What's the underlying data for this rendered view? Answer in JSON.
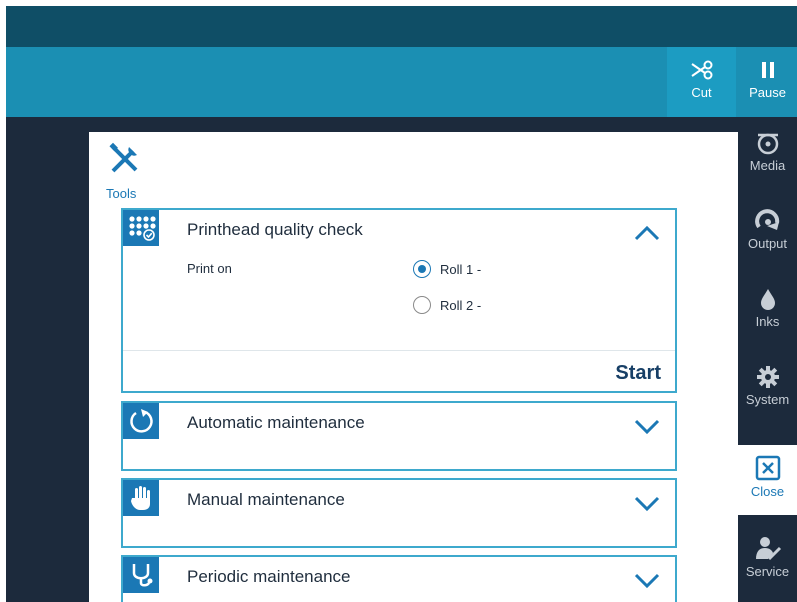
{
  "toolbar": {
    "cut_label": "Cut",
    "pause_label": "Pause"
  },
  "sidebar": {
    "items": [
      {
        "label": "Media",
        "icon": "media-roll-icon"
      },
      {
        "label": "Output",
        "icon": "output-icon"
      },
      {
        "label": "Inks",
        "icon": "ink-drop-icon"
      },
      {
        "label": "System",
        "icon": "gear-icon"
      },
      {
        "label": "Close",
        "icon": "close-icon"
      },
      {
        "label": "Service",
        "icon": "service-icon"
      }
    ]
  },
  "tools": {
    "label": "Tools",
    "icon": "tools-icon"
  },
  "cards": [
    {
      "title": "Printhead quality check",
      "icon": "printhead-check-icon",
      "expanded": true,
      "print_on_label": "Print on",
      "options": [
        {
          "label": "Roll 1 -",
          "selected": true
        },
        {
          "label": "Roll 2 -",
          "selected": false
        }
      ],
      "start_label": "Start"
    },
    {
      "title": "Automatic maintenance",
      "icon": "refresh-icon",
      "expanded": false
    },
    {
      "title": "Manual maintenance",
      "icon": "hand-icon",
      "expanded": false
    },
    {
      "title": "Periodic maintenance",
      "icon": "stethoscope-icon",
      "expanded": false
    }
  ],
  "colors": {
    "accent": "#1b78b5",
    "toolbar_blue": "#1b8fb3",
    "dark_bg": "#1c2a3c",
    "card_border": "#3ea9cd"
  }
}
